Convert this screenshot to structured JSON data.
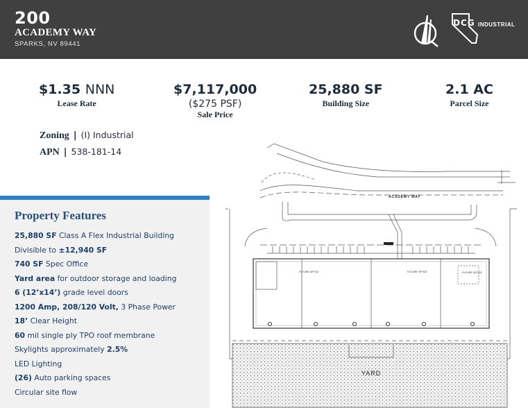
{
  "header": {
    "number": "200",
    "street": "ACADEMY WAY",
    "city": "SPARKS, NV 89441",
    "logo_dcg": "DCG",
    "logo_industrial": "INDUSTRIAL",
    "background_color": "#404040"
  },
  "stats": {
    "lease": {
      "value": "$1.35",
      "unit": "NNN",
      "label": "Lease Rate"
    },
    "sale": {
      "value": "$7,117,000",
      "sub": "($275 PSF)",
      "label": "Sale Price"
    },
    "building": {
      "value": "25,880 SF",
      "label": "Building Size"
    },
    "parcel": {
      "value": "2.1 AC",
      "label": "Parcel Size"
    }
  },
  "info": {
    "zoning_label": "Zoning",
    "zoning_value": "(I) Industrial",
    "apn_label": "APN",
    "apn_value": "538-181-14",
    "separator": "|"
  },
  "features": {
    "title": "Property Features",
    "accent_color": "#2f7fc1",
    "items": [
      {
        "bold": "25,880 SF",
        "text": " Class A Flex Industrial Building",
        "bold_after": ""
      },
      {
        "bold": "",
        "text": "Divisible to ",
        "bold_after": "±12,940 SF"
      },
      {
        "bold": "740 SF",
        "text": " Spec Office",
        "bold_after": ""
      },
      {
        "bold": "Yard area",
        "text": " for outdoor storage and loading",
        "bold_after": ""
      },
      {
        "bold": "6 (12’x14’)",
        "text": " grade level doors",
        "bold_after": ""
      },
      {
        "bold": "1200 Amp, 208/120 Volt,",
        "text": " 3 Phase Power",
        "bold_after": ""
      },
      {
        "bold": "18’",
        "text": " Clear Height",
        "bold_after": ""
      },
      {
        "bold": "60",
        "text": " mil single ply TPO roof membrane",
        "bold_after": ""
      },
      {
        "bold": "",
        "text": "Skylights approximately ",
        "bold_after": "2.5%"
      },
      {
        "bold": "",
        "text": "LED Lighting",
        "bold_after": ""
      },
      {
        "bold": "(26)",
        "text": " Auto parking spaces",
        "bold_after": ""
      },
      {
        "bold": "",
        "text": "Circular site flow",
        "bold_after": ""
      }
    ]
  },
  "siteplan": {
    "street_label": "ACADEMY WAY",
    "yard_label": "YARD",
    "office_labels": [
      "FUTURE OFFICE",
      "FUTURE OFFICE",
      "FUTURE OFFICE"
    ]
  }
}
